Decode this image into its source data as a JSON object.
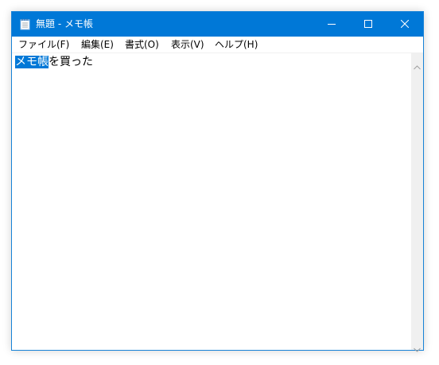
{
  "window": {
    "title": "無題 - メモ帳",
    "title_bar_color": "#0078d7"
  },
  "titlebar_controls": {
    "minimize": "minimize-icon",
    "maximize": "maximize-icon",
    "close": "close-icon"
  },
  "menu": [
    {
      "label": "ファイル(F)"
    },
    {
      "label": "編集(E)"
    },
    {
      "label": "書式(O)"
    },
    {
      "label": "表示(V)"
    },
    {
      "label": "ヘルプ(H)"
    }
  ],
  "editor": {
    "selected_text": "メモ帳",
    "rest_text": "を買った",
    "selection_color": "#0078d7"
  },
  "icons": {
    "app": "notepad-icon",
    "scroll_up": "chevron-up-icon",
    "scroll_down": "chevron-down-icon"
  }
}
